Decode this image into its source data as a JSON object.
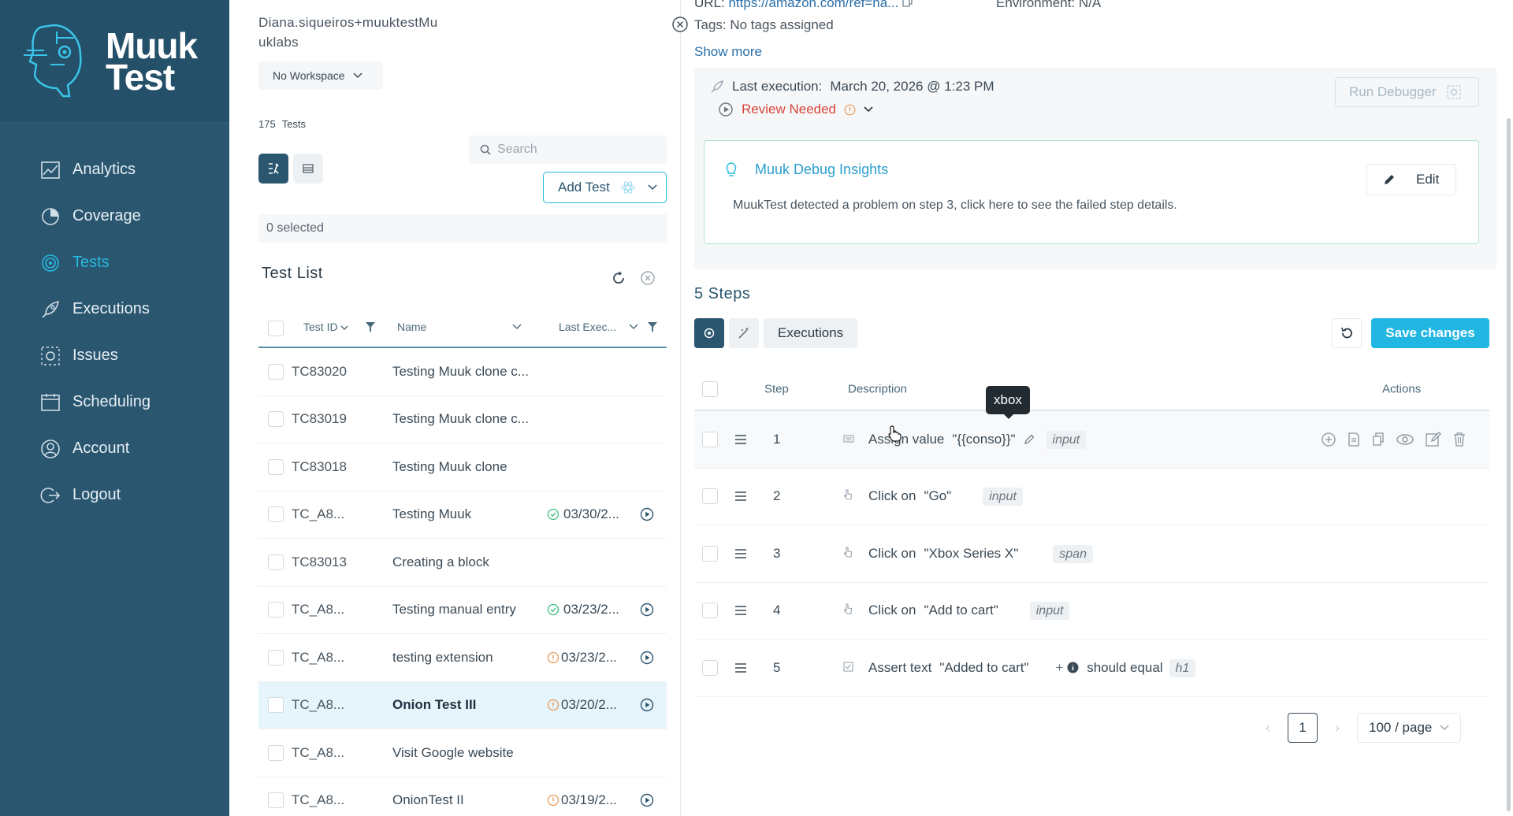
{
  "sidebar": {
    "logo_text_1": "Muuk",
    "logo_text_2": "Test",
    "items": [
      {
        "label": "Analytics",
        "icon": "chart-icon"
      },
      {
        "label": "Coverage",
        "icon": "coverage-icon"
      },
      {
        "label": "Tests",
        "icon": "tests-icon",
        "active": true
      },
      {
        "label": "Executions",
        "icon": "rocket-icon"
      },
      {
        "label": "Issues",
        "icon": "bug-icon"
      },
      {
        "label": "Scheduling",
        "icon": "calendar-icon"
      },
      {
        "label": "Account",
        "icon": "user-icon"
      },
      {
        "label": "Logout",
        "icon": "logout-icon"
      }
    ]
  },
  "user": {
    "name": "Diana.siqueiros+muuktestMuuklabs",
    "name_line1": "Diana.siqueiros+muuktestMu",
    "name_line2": "uklabs"
  },
  "workspace": {
    "label": "No Workspace"
  },
  "tests_count": {
    "number": "175",
    "label": "Tests"
  },
  "search": {
    "placeholder": "Search"
  },
  "add_test": {
    "label": "Add Test"
  },
  "selection": {
    "text": "0 selected"
  },
  "test_list": {
    "title": "Test List",
    "columns": {
      "id": "Test ID",
      "name": "Name",
      "last_exec": "Last Exec..."
    },
    "rows": [
      {
        "id": "TC83020",
        "name": "Testing Muuk clone c...",
        "status": "",
        "date": ""
      },
      {
        "id": "TC83019",
        "name": "Testing Muuk clone c...",
        "status": "",
        "date": ""
      },
      {
        "id": "TC83018",
        "name": "Testing Muuk clone",
        "status": "",
        "date": ""
      },
      {
        "id": "TC_A8...",
        "name": "Testing Muuk",
        "status": "pass",
        "date": "03/30/2..."
      },
      {
        "id": "TC83013",
        "name": "Creating a block",
        "status": "",
        "date": ""
      },
      {
        "id": "TC_A8...",
        "name": "Testing manual entry",
        "status": "pass",
        "date": "03/23/2..."
      },
      {
        "id": "TC_A8...",
        "name": "testing extension",
        "status": "warn",
        "date": "03/23/2..."
      },
      {
        "id": "TC_A8...",
        "name": "Onion Test III",
        "status": "warn",
        "date": "03/20/2...",
        "selected": true
      },
      {
        "id": "TC_A8...",
        "name": "Visit Google website",
        "status": "",
        "date": ""
      },
      {
        "id": "TC_A8...",
        "name": "OnionTest II",
        "status": "warn",
        "date": "03/19/2..."
      }
    ]
  },
  "details": {
    "url_label": "URL:",
    "url_value": "https://amazon.com/ref=na...",
    "environment": "Environment: N/A",
    "tags": "Tags: No tags assigned",
    "show_more": "Show more",
    "last_execution_label": "Last execution:",
    "last_execution_value": "March 20, 2026 @ 1:23 PM",
    "review_status": "Review Needed",
    "run_debugger": "Run Debugger",
    "insights_title": "Muuk Debug Insights",
    "insights_text": "MuukTest detected a problem on step 3, click here to see the failed step details.",
    "edit_label": "Edit"
  },
  "steps": {
    "title": "5 Steps",
    "executions_tab": "Executions",
    "save_label": "Save changes",
    "columns": {
      "step": "Step",
      "description": "Description",
      "actions": "Actions"
    },
    "rows": [
      {
        "num": "1",
        "action": "Assign value",
        "target": "\"{{conso}}\"",
        "tag": "input",
        "extra": ""
      },
      {
        "num": "2",
        "action": "Click on",
        "target": "\"Go\"",
        "tag": "input",
        "extra": ""
      },
      {
        "num": "3",
        "action": "Click on",
        "target": "\"Xbox Series X\"",
        "tag": "span",
        "extra": ""
      },
      {
        "num": "4",
        "action": "Click on",
        "target": "\"Add to cart\"",
        "tag": "input",
        "extra": ""
      },
      {
        "num": "5",
        "action": "Assert text",
        "target": "\"Added to cart\"",
        "tag": "h1",
        "extra": "should equal"
      }
    ],
    "tooltip": "xbox"
  },
  "pagination": {
    "page": "1",
    "per_page": "100 / page"
  },
  "colors": {
    "sidebar": "#2a5670",
    "accent": "#22b6e3",
    "error": "#d8453a",
    "success": "#3fbf7f"
  }
}
